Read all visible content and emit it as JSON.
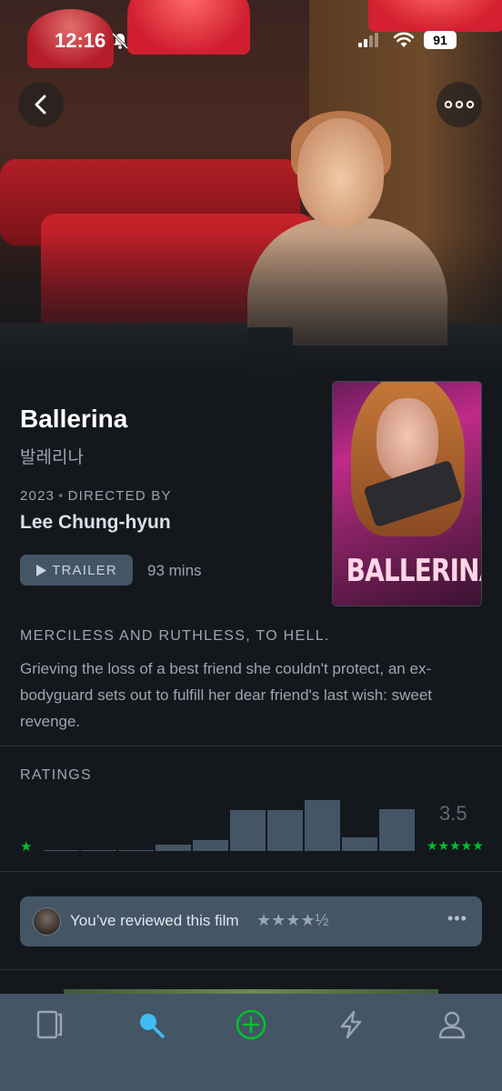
{
  "status_bar": {
    "time": "12:16",
    "battery": "91"
  },
  "film": {
    "title": "Ballerina",
    "original_title": "발레리나",
    "year": "2023",
    "directed_by_label": "DIRECTED BY",
    "director": "Lee Chung-hyun",
    "trailer_label": "TRAILER",
    "runtime": "93 mins",
    "poster_title": "BALLERINA",
    "tagline": "MERCILESS AND RUTHLESS, TO HELL.",
    "synopsis": "Grieving the loss of a best friend she couldn't protect, an ex-bodyguard sets out to fulfill her dear friend's last wish: sweet revenge."
  },
  "ratings": {
    "label": "RATINGS",
    "low_star": "★",
    "high_stars": "★★★★★",
    "average": "3.5",
    "histogram": [
      0.02,
      0.02,
      0.02,
      0.13,
      0.22,
      0.8,
      0.8,
      1.0,
      0.27,
      0.82
    ]
  },
  "review": {
    "text": "You’ve reviewed this film",
    "stars": "★★★★½",
    "more": "•••"
  },
  "tabs": [
    "films-icon",
    "search-icon",
    "add-icon",
    "activity-icon",
    "profile-icon"
  ],
  "colors": {
    "accent_green": "#00c030",
    "accent_blue": "#40bcf4",
    "surface": "#445566",
    "background": "#14181c"
  }
}
